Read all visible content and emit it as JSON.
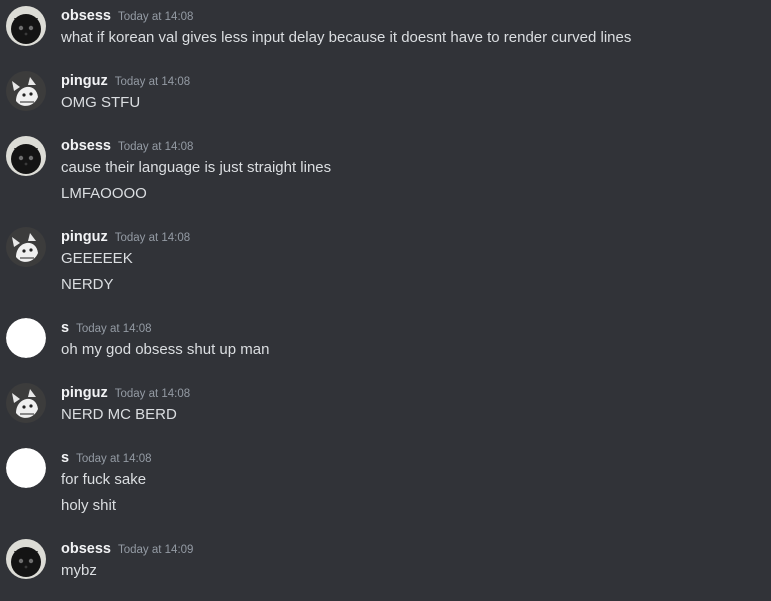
{
  "messages": [
    {
      "author": "obsess",
      "timestamp": "Today at 14:08",
      "avatar": "dark-cat-avatar",
      "lines": [
        "what if korean val gives less input delay because it doesnt have to render curved lines"
      ]
    },
    {
      "author": "pinguz",
      "timestamp": "Today at 14:08",
      "avatar": "anime-sketch-avatar",
      "lines": [
        "OMG STFU"
      ]
    },
    {
      "author": "obsess",
      "timestamp": "Today at 14:08",
      "avatar": "dark-cat-avatar",
      "lines": [
        "cause their language is just straight lines",
        "LMFAOOOO"
      ]
    },
    {
      "author": "pinguz",
      "timestamp": "Today at 14:08",
      "avatar": "anime-sketch-avatar",
      "lines": [
        "GEEEEEK",
        "NERDY"
      ]
    },
    {
      "author": "s",
      "timestamp": "Today at 14:08",
      "avatar": "blank-white-avatar",
      "lines": [
        "oh my god obsess shut up man"
      ]
    },
    {
      "author": "pinguz",
      "timestamp": "Today at 14:08",
      "avatar": "anime-sketch-avatar",
      "lines": [
        "NERD MC BERD"
      ]
    },
    {
      "author": "s",
      "timestamp": "Today at 14:08",
      "avatar": "blank-white-avatar",
      "lines": [
        "for fuck sake",
        "holy shit"
      ]
    },
    {
      "author": "obsess",
      "timestamp": "Today at 14:09",
      "avatar": "dark-cat-avatar",
      "lines": [
        "mybz"
      ]
    }
  ],
  "colors": {
    "background": "#313338",
    "username": "#f2f3f5",
    "timestamp": "#949ba4",
    "message_text": "#dbdee1"
  }
}
